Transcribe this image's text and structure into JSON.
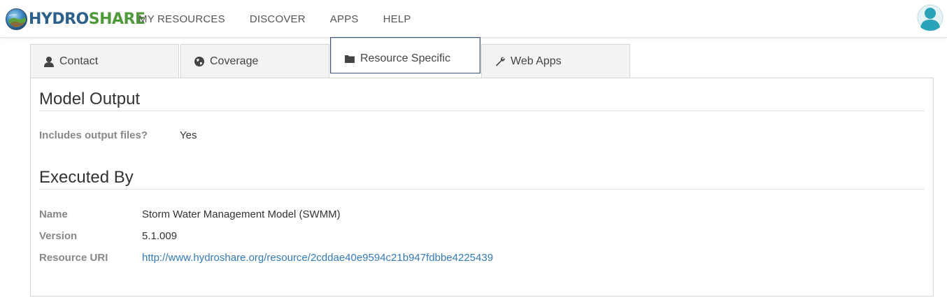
{
  "brand": {
    "part1": "HYDRO",
    "part2": "SHARE"
  },
  "nav": {
    "items": [
      "MY RESOURCES",
      "DISCOVER",
      "APPS",
      "HELP"
    ]
  },
  "tabs": [
    {
      "label": "Contact",
      "icon": "user-icon"
    },
    {
      "label": "Coverage",
      "icon": "globe-icon"
    },
    {
      "label": "Resource Specific",
      "icon": "folder-icon",
      "active": true
    },
    {
      "label": "Web Apps",
      "icon": "wrench-icon"
    }
  ],
  "model_output": {
    "title": "Model Output",
    "includes_label": "Includes output files?",
    "includes_value": "Yes"
  },
  "executed_by": {
    "title": "Executed By",
    "name_label": "Name",
    "name_value": "Storm Water Management Model (SWMM)",
    "version_label": "Version",
    "version_value": "5.1.009",
    "uri_label": "Resource URI",
    "uri_value": "http://www.hydroshare.org/resource/2cddae40e9594c21b947fdbbe4225439"
  },
  "colors": {
    "accent": "#37587c",
    "link": "#337ab7",
    "brand_blue": "#2c5f8a",
    "brand_green": "#4f9a3a"
  }
}
